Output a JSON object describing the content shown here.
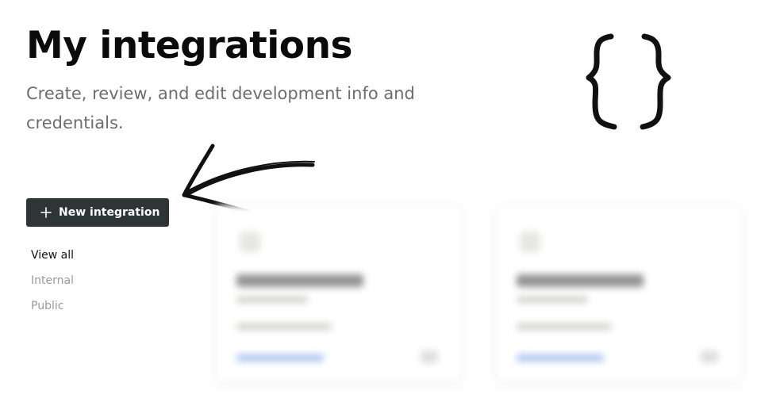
{
  "header": {
    "title": "My integrations",
    "subtitle": "Create, review, and edit development info and credentials."
  },
  "actions": {
    "new_integration_label": "New integration",
    "new_integration_icon": "plus-icon"
  },
  "filters": {
    "items": [
      {
        "label": "View all",
        "active": true
      },
      {
        "label": "Internal",
        "active": false
      },
      {
        "label": "Public",
        "active": false
      }
    ]
  },
  "decor": {
    "braces_icon": "curly-braces-icon",
    "arrow_icon": "hand-drawn-arrow-icon"
  },
  "colors": {
    "button_bg": "#2f3437",
    "muted_text": "#9b9a97",
    "subtitle_text": "#6d6d6d",
    "link_blue": "#a9c6ee"
  }
}
